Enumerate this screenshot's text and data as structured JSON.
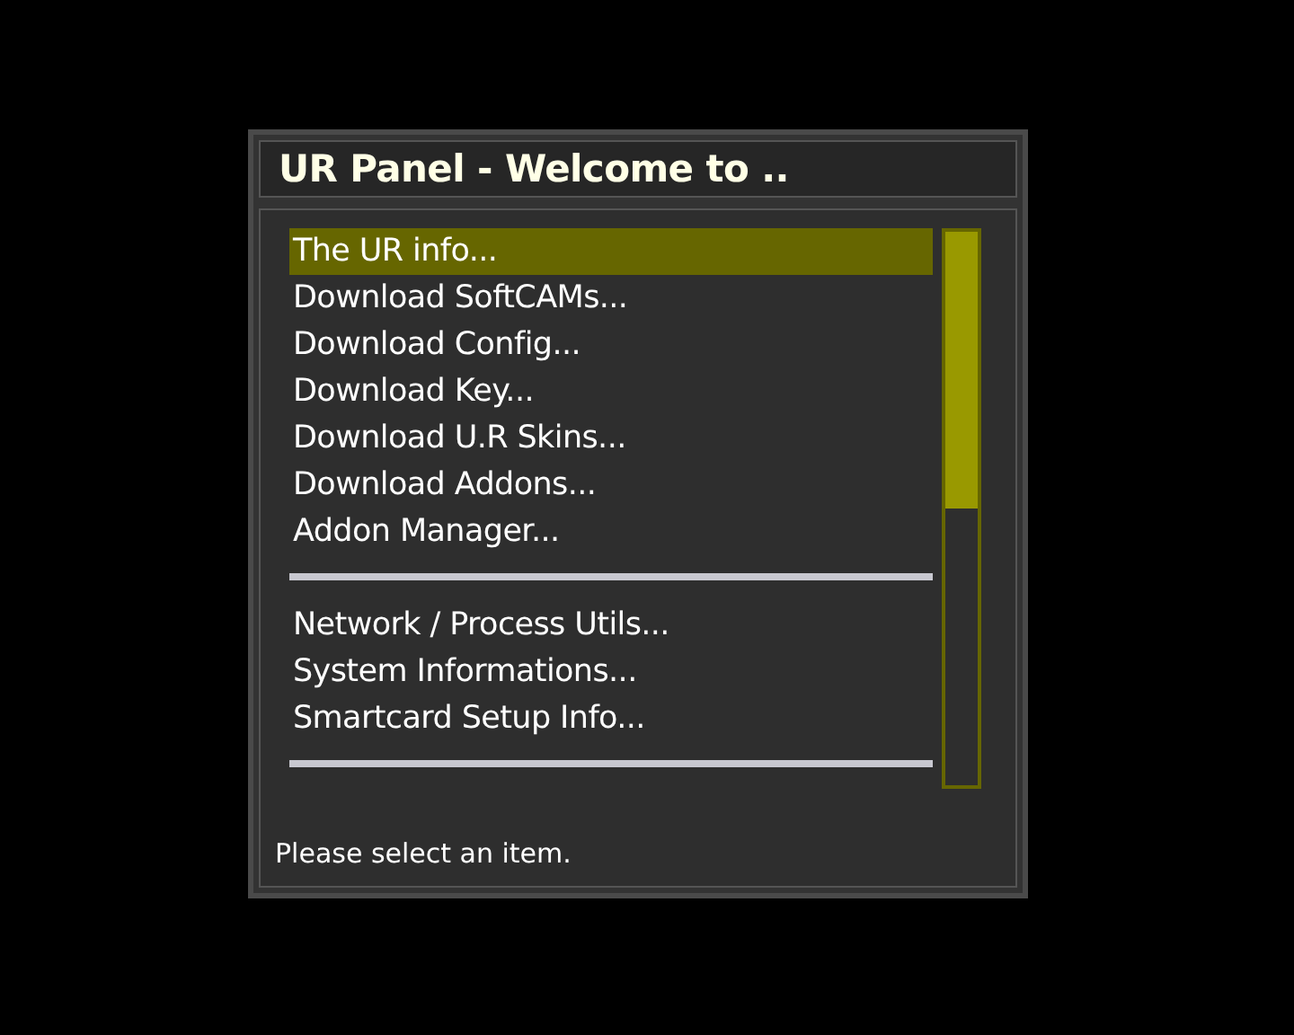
{
  "window": {
    "title": "UR Panel - Welcome to .."
  },
  "menu": [
    {
      "kind": "item",
      "label": "The UR info...",
      "selected": true
    },
    {
      "kind": "item",
      "label": "Download SoftCAMs...",
      "selected": false
    },
    {
      "kind": "item",
      "label": "Download Config...",
      "selected": false
    },
    {
      "kind": "item",
      "label": "Download Key...",
      "selected": false
    },
    {
      "kind": "item",
      "label": "Download U.R Skins...",
      "selected": false
    },
    {
      "kind": "item",
      "label": "Download Addons...",
      "selected": false
    },
    {
      "kind": "item",
      "label": "Addon Manager...",
      "selected": false
    },
    {
      "kind": "separator"
    },
    {
      "kind": "item",
      "label": "Network / Process Utils...",
      "selected": false
    },
    {
      "kind": "item",
      "label": "System Informations...",
      "selected": false
    },
    {
      "kind": "item",
      "label": "Smartcard Setup Info...",
      "selected": false
    },
    {
      "kind": "separator"
    }
  ],
  "status_bar": "Please select an item."
}
